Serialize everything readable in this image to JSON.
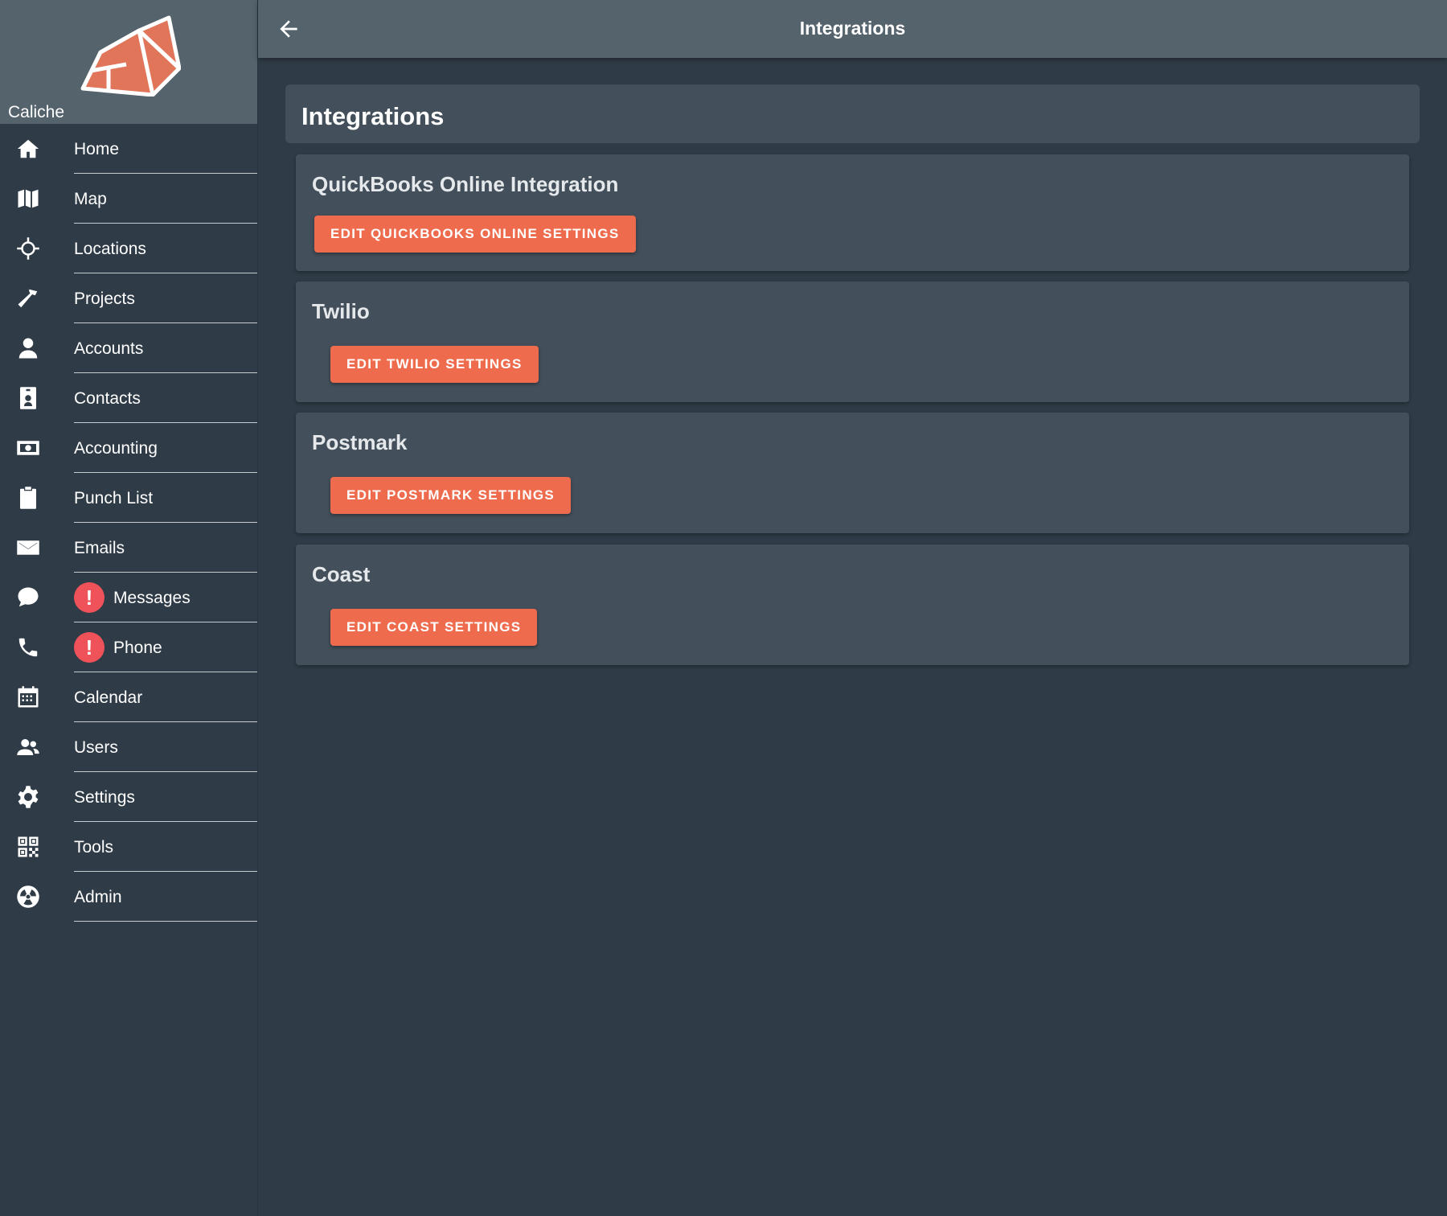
{
  "app": {
    "brand_name": "Caliche",
    "accent_color": "#ee6c4d",
    "alert_color": "#f0525a"
  },
  "topbar": {
    "title": "Integrations",
    "back_icon": "arrow-left-icon"
  },
  "sidebar": {
    "items": [
      {
        "label": "Home",
        "icon": "home-icon",
        "alert": false
      },
      {
        "label": "Map",
        "icon": "map-icon",
        "alert": false
      },
      {
        "label": "Locations",
        "icon": "crosshair-icon",
        "alert": false
      },
      {
        "label": "Projects",
        "icon": "hammer-icon",
        "alert": false
      },
      {
        "label": "Accounts",
        "icon": "person-icon",
        "alert": false
      },
      {
        "label": "Contacts",
        "icon": "contact-card-icon",
        "alert": false
      },
      {
        "label": "Accounting",
        "icon": "money-icon",
        "alert": false
      },
      {
        "label": "Punch List",
        "icon": "clipboard-icon",
        "alert": false
      },
      {
        "label": "Emails",
        "icon": "envelope-icon",
        "alert": false
      },
      {
        "label": "Messages",
        "icon": "chat-icon",
        "alert": true,
        "alert_text": "!"
      },
      {
        "label": "Phone",
        "icon": "phone-icon",
        "alert": true,
        "alert_text": "!"
      },
      {
        "label": "Calendar",
        "icon": "calendar-icon",
        "alert": false
      },
      {
        "label": "Users",
        "icon": "users-icon",
        "alert": false
      },
      {
        "label": "Settings",
        "icon": "gear-icon",
        "alert": false
      },
      {
        "label": "Tools",
        "icon": "qr-code-icon",
        "alert": false
      },
      {
        "label": "Admin",
        "icon": "radiation-icon",
        "alert": false
      }
    ]
  },
  "main": {
    "page_title": "Integrations",
    "cards": [
      {
        "title": "QuickBooks Online Integration",
        "button_label": "Edit QuickBooks Online Settings"
      },
      {
        "title": "Twilio",
        "button_label": "Edit Twilio Settings"
      },
      {
        "title": "Postmark",
        "button_label": "Edit Postmark Settings"
      },
      {
        "title": "Coast",
        "button_label": "Edit Coast Settings"
      }
    ]
  }
}
